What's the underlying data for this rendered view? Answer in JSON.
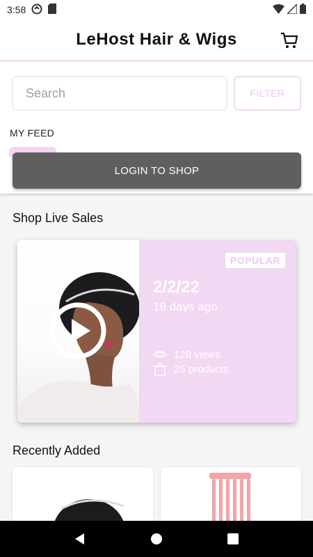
{
  "status": {
    "time": "3:58"
  },
  "header": {
    "title": "LeHost Hair & Wigs"
  },
  "search": {
    "placeholder": "Search"
  },
  "filter": {
    "label": "FILTER"
  },
  "feed": {
    "label": "MY FEED"
  },
  "login": {
    "label": "LOGIN TO SHOP"
  },
  "live_sales": {
    "title": "Shop Live Sales",
    "card": {
      "badge": "POPULAR",
      "date": "2/2/22",
      "ago": "18 days ago",
      "views": "128 views",
      "products": "25 products"
    }
  },
  "recently_added": {
    "title": "Recently Added"
  },
  "colors": {
    "accent": "#f1d8f3",
    "accent_text": "#f0c6f0",
    "login_bg": "#5f5f5f"
  }
}
